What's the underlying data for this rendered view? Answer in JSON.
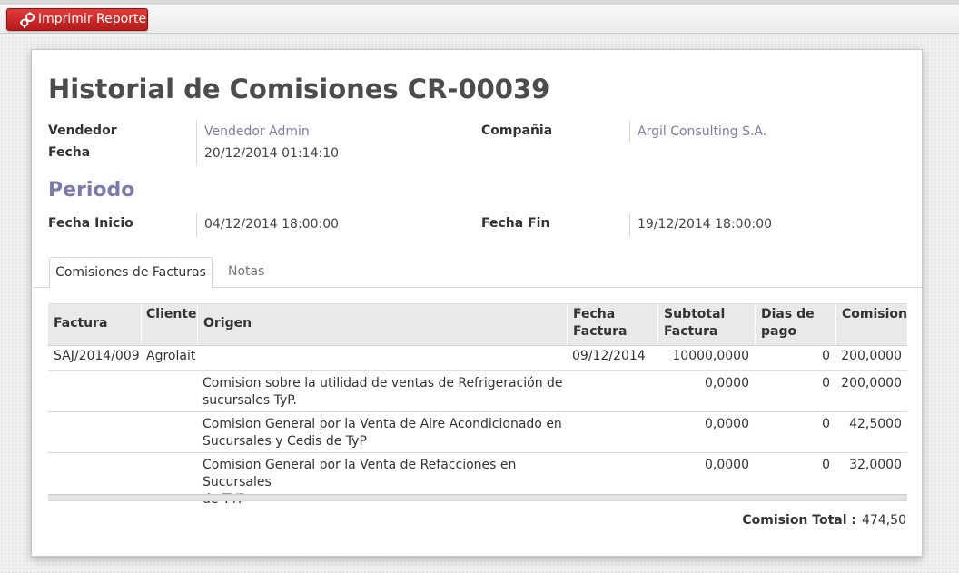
{
  "toolbar": {
    "print_label": "Imprimir Reporte"
  },
  "record": {
    "title": "Historial de Comisiones CR-00039",
    "vendedor_label": "Vendedor",
    "vendedor_value": "Vendedor Admin",
    "compania_label": "Compañia",
    "compania_value": "Argil Consulting S.A.",
    "fecha_label": "Fecha",
    "fecha_value": "20/12/2014 01:14:10"
  },
  "periodo": {
    "heading": "Periodo",
    "inicio_label": "Fecha Inicio",
    "inicio_value": "04/12/2014 18:00:00",
    "fin_label": "Fecha Fin",
    "fin_value": "19/12/2014 18:00:00"
  },
  "tabs": [
    {
      "label": "Comisiones de Facturas",
      "active": true
    },
    {
      "label": "Notas",
      "active": false
    }
  ],
  "table": {
    "columns": {
      "factura": "Factura",
      "cliente": "Cliente",
      "origen": "Origen",
      "fecha_factura_1": "Fecha",
      "fecha_factura_2": "Factura",
      "subtotal_1": "Subtotal",
      "subtotal_2": "Factura",
      "dias_1": "Dias de",
      "dias_2": "pago",
      "comision": "Comision"
    },
    "rows": [
      {
        "factura": "SAJ/2014/009",
        "cliente": "Agrolait",
        "origen_1": "",
        "origen_2": "",
        "fecha": "09/12/2014",
        "subtotal": "10000,0000",
        "dias": "0",
        "comision": "200,0000"
      },
      {
        "factura": "",
        "cliente": "",
        "origen_1": "Comision sobre la utilidad de ventas de Refrigeración de",
        "origen_2": "sucursales TyP.",
        "fecha": "",
        "subtotal": "0,0000",
        "dias": "0",
        "comision": "200,0000"
      },
      {
        "factura": "",
        "cliente": "",
        "origen_1": "Comision General por la Venta de Aire Acondicionado en",
        "origen_2": "Sucursales y Cedis de TyP",
        "fecha": "",
        "subtotal": "0,0000",
        "dias": "0",
        "comision": "42,5000"
      },
      {
        "factura": "",
        "cliente": "",
        "origen_1": "Comision General por la Venta de Refacciones en Sucursales",
        "origen_2": "de TYP",
        "fecha": "",
        "subtotal": "0,0000",
        "dias": "0",
        "comision": "32,0000"
      }
    ]
  },
  "totals": {
    "label": "Comision Total :",
    "value": "474,50"
  }
}
